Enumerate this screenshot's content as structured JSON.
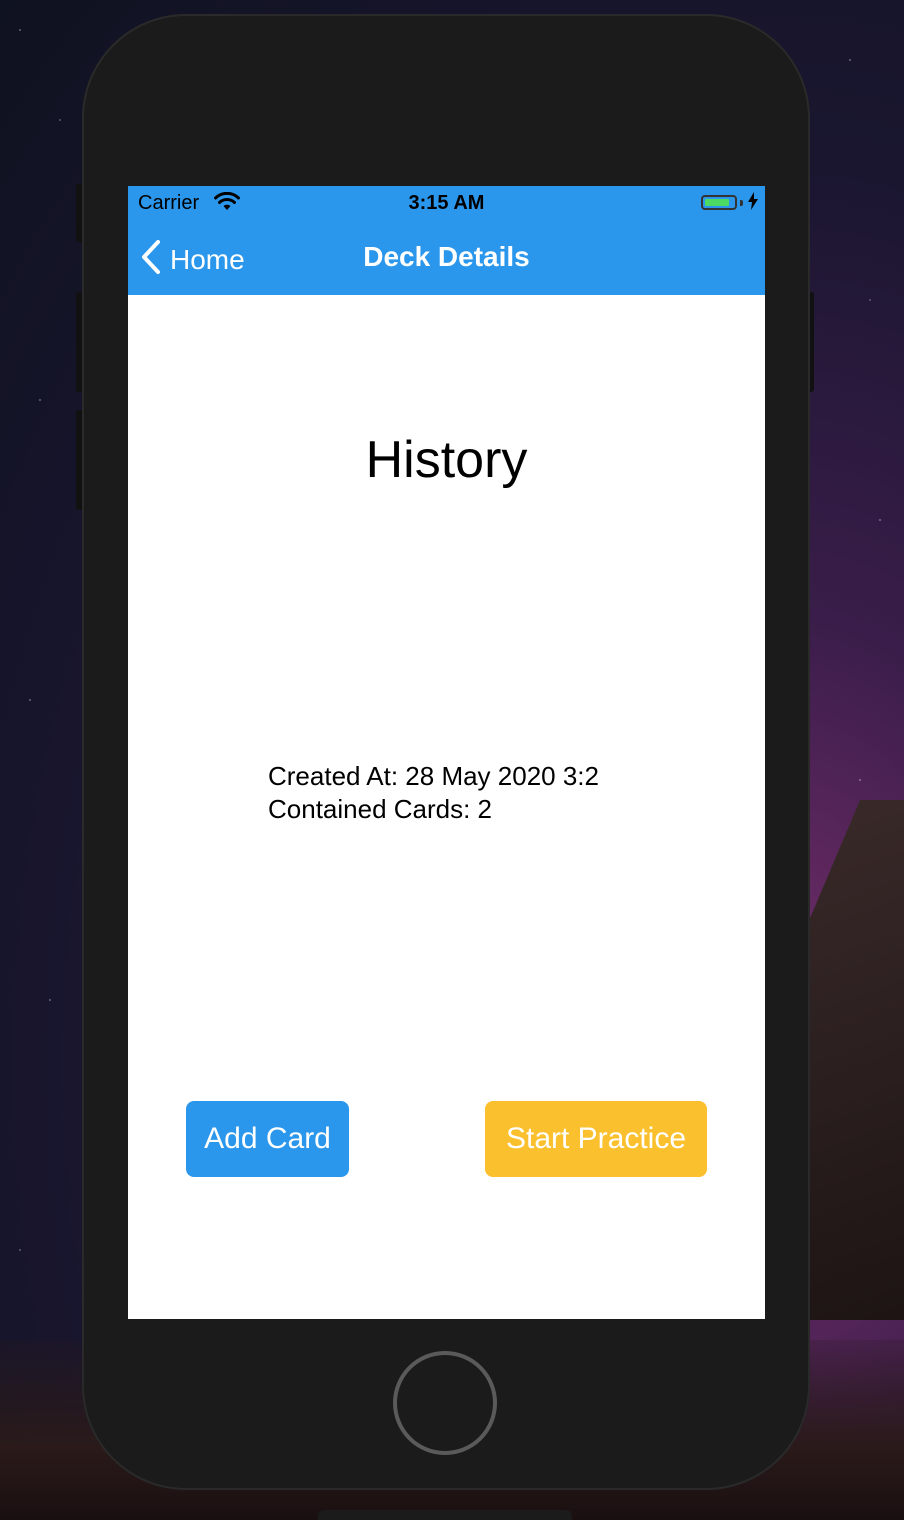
{
  "status_bar": {
    "carrier": "Carrier",
    "time": "3:15 AM",
    "battery_level": 0.85,
    "charging": true
  },
  "nav": {
    "back_label": "Home",
    "title": "Deck Details"
  },
  "deck": {
    "name": "History",
    "created_at": "Created At: 28 May 2020 3:2",
    "contained_cards": "Contained Cards: 2"
  },
  "buttons": {
    "add_card": "Add Card",
    "start_practice": "Start Practice"
  },
  "colors": {
    "accent_blue": "#2b97ec",
    "accent_yellow": "#fbc02d"
  }
}
